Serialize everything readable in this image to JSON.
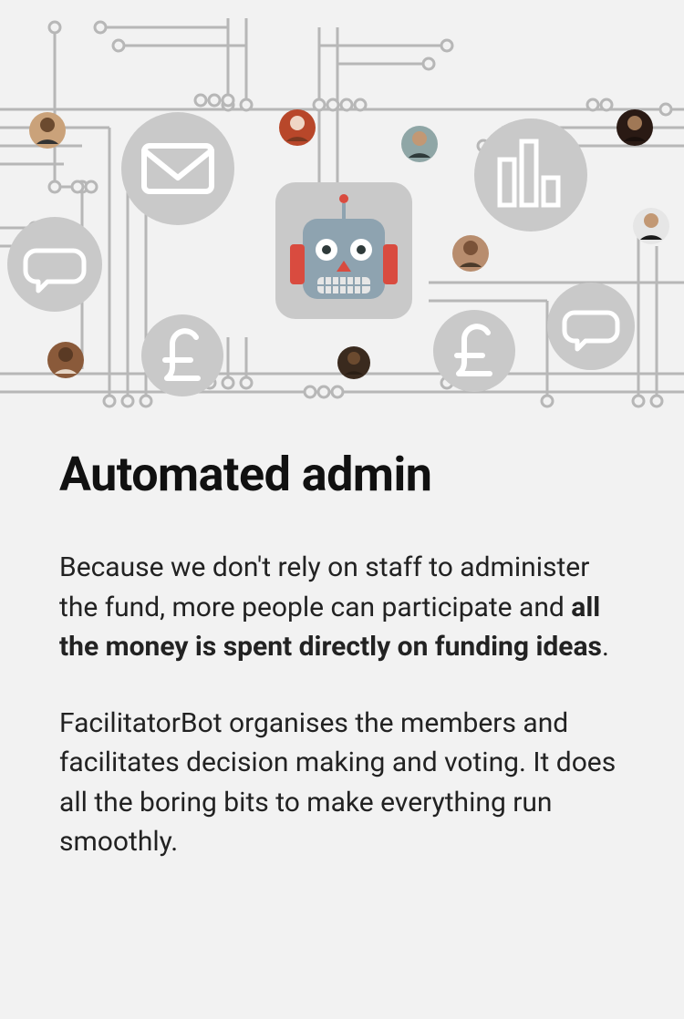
{
  "heading": "Automated admin",
  "paragraph1_pre": "Because we don't rely on staff to administer the fund, more people can participate and ",
  "paragraph1_bold": "all the money is spent directly on funding ideas",
  "paragraph1_post": ".",
  "paragraph2": "FacilitatorBot organises the members and facilitates decision making and voting. It does all the boring bits to make everything run smoothly."
}
